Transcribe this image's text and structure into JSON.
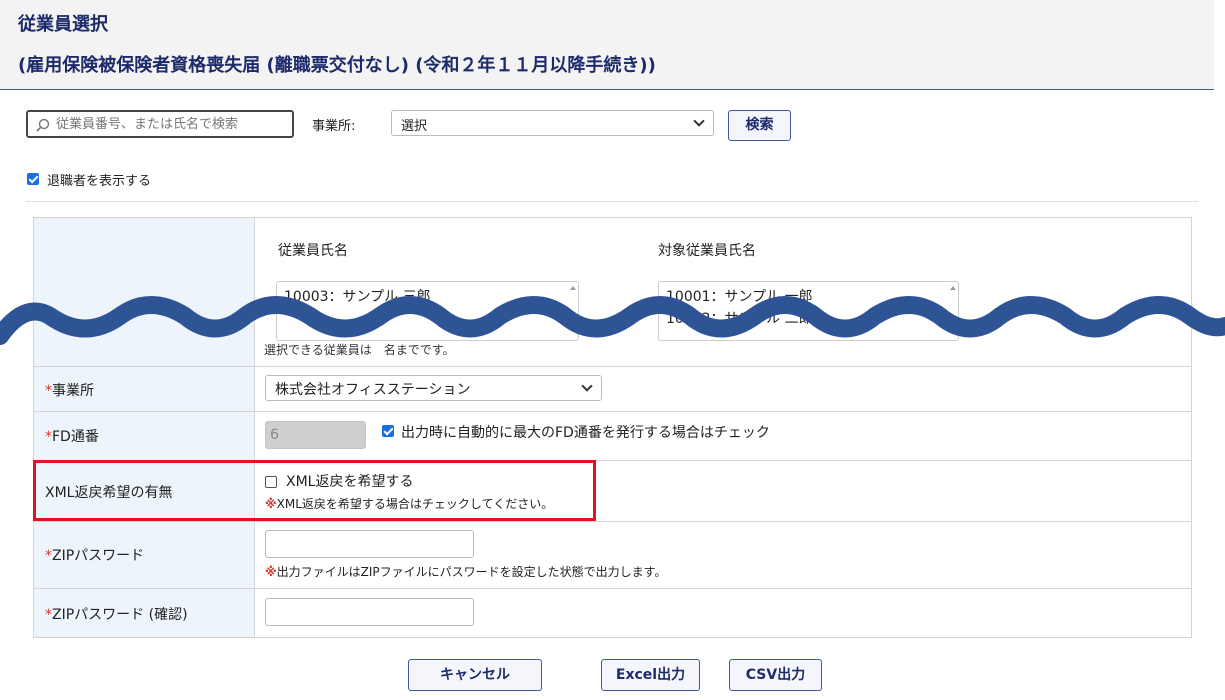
{
  "header": {
    "title": "従業員選択",
    "subtitle": "(雇用保険被保険者資格喪失届 (離職票交付なし) (令和２年１１月以降手続き))"
  },
  "search": {
    "placeholder": "従業員番号、または氏名で検索",
    "office_label": "事業所:",
    "office_value": "選択",
    "search_button": "検索"
  },
  "show_retired": {
    "label": "退職者を表示する",
    "checked": true
  },
  "employee_select": {
    "list_title": "従業員氏名",
    "list_items": [
      "10003：サンプル 三郎"
    ],
    "target_title": "対象従業員氏名",
    "target_items": [
      "10001：サンプル 一郎",
      "10002：サンプル 二郎"
    ],
    "note": "選択できる従業員は　名までです。"
  },
  "rows": {
    "office": {
      "required": "*",
      "label": "事業所",
      "value": "株式会社オフィスステーション"
    },
    "fd": {
      "required": "*",
      "label": "FD通番",
      "value": "6",
      "auto_label": "出力時に自動的に最大のFD通番を発行する場合はチェック",
      "auto_checked": true
    },
    "xml": {
      "label": "XML返戻希望の有無",
      "checkbox_label": "XML返戻を希望する",
      "checked": false,
      "note_mark": "※",
      "note": "XML返戻を希望する場合はチェックしてください。"
    },
    "zip": {
      "required": "*",
      "label": "ZIPパスワード",
      "value": "",
      "note_mark": "※",
      "note": "出力ファイルはZIPファイルにパスワードを設定した状態で出力します。"
    },
    "zip_confirm": {
      "required": "*",
      "label": "ZIPパスワード (確認)",
      "value": ""
    }
  },
  "footer": {
    "cancel": "キャンセル",
    "excel": "Excel出力",
    "csv": "CSV出力"
  },
  "colors": {
    "accent": "#1d2b6b",
    "required": "#e0352b",
    "highlight": "#e0141e",
    "wave": "#2f5496"
  }
}
